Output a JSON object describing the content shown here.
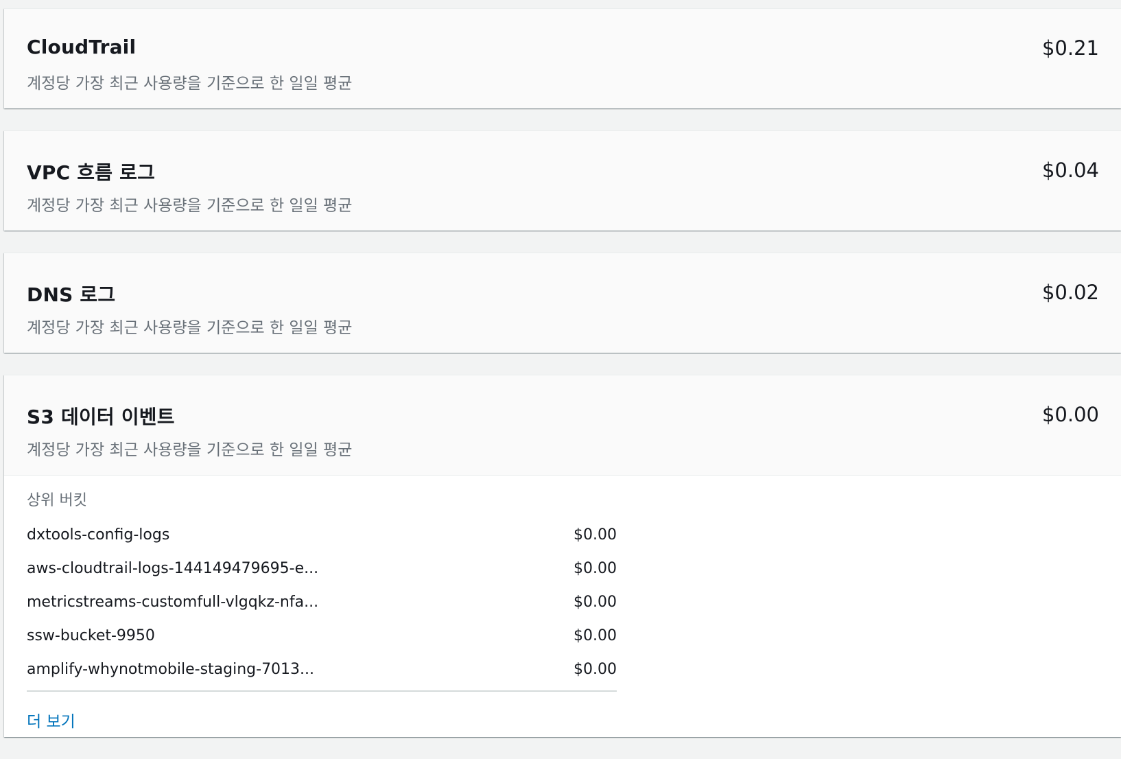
{
  "cards": [
    {
      "title": "CloudTrail",
      "subtitle": "계정당 가장 최근 사용량을 기준으로 한 일일 평균",
      "cost": "$0.21"
    },
    {
      "title": "VPC 흐름 로그",
      "subtitle": "계정당 가장 최근 사용량을 기준으로 한 일일 평균",
      "cost": "$0.04"
    },
    {
      "title": "DNS 로그",
      "subtitle": "계정당 가장 최근 사용량을 기준으로 한 일일 평균",
      "cost": "$0.02"
    },
    {
      "title": "S3 데이터 이벤트",
      "subtitle": "계정당 가장 최근 사용량을 기준으로 한 일일 평균",
      "cost": "$0.00",
      "buckets_heading": "상위 버킷",
      "buckets": [
        {
          "name": "dxtools-config-logs",
          "cost": "$0.00"
        },
        {
          "name": "aws-cloudtrail-logs-144149479695-e...",
          "cost": "$0.00"
        },
        {
          "name": "metricstreams-customfull-vlgqkz-nfa...",
          "cost": "$0.00"
        },
        {
          "name": "ssw-bucket-9950",
          "cost": "$0.00"
        },
        {
          "name": "amplify-whynotmobile-staging-7013...",
          "cost": "$0.00"
        }
      ],
      "more_label": "더 보기"
    }
  ]
}
